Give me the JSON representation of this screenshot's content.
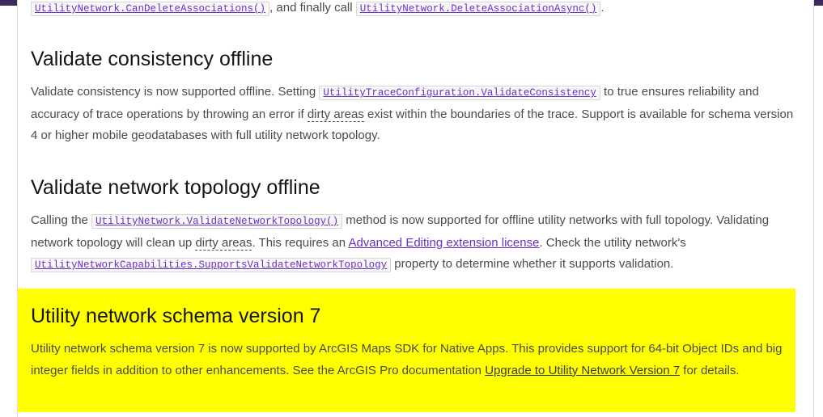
{
  "top_line": {
    "code1": "UtilityNetwork.CanDeleteAssociations()",
    "text1": ", and finally call ",
    "code2": "UtilityNetwork.DeleteAssociationAsync()",
    "text2": "."
  },
  "section1": {
    "title": "Validate consistency offline",
    "text_a": "Validate consistency is now supported offline. Setting ",
    "code": "UtilityTraceConfiguration.ValidateConsistency",
    "text_b": " to true ensures reliability and accuracy of trace operations by throwing an error if ",
    "term": "dirty areas",
    "text_c": " exist within the boundaries of the trace. Support is available for schema version 4 or higher mobile geodatabases with full utility network topology."
  },
  "section2": {
    "title": "Validate network topology offline",
    "text_a": "Calling the ",
    "code1": "UtilityNetwork.ValidateNetworkTopology()",
    "text_b": " method is now supported for offline utility networks with full topology. Validating network topology will clean up ",
    "term": "dirty areas",
    "text_c": ". This requires an ",
    "link": "Advanced Editing extension license",
    "text_d": ". Check the utility network's ",
    "code2": "UtilityNetworkCapabilities.SupportsValidateNetworkTopology",
    "text_e": " property to determine whether it supports validation."
  },
  "section3": {
    "title": "Utility network schema version 7",
    "text_a": "Utility network schema version 7 is now supported by ArcGIS Maps SDK for Native Apps. This provides support for 64-bit Object IDs and big integer fields in addition to other enhancements. See the ArcGIS Pro documentation ",
    "link": "Upgrade to Utility Network Version 7",
    "text_b": " for details.",
    "highlight_color": "#ffff00"
  },
  "colors": {
    "top_bar": "#3b2a5c",
    "link": "#6b2fc7",
    "heading": "#151515",
    "body_text": "#4a4a4a"
  }
}
